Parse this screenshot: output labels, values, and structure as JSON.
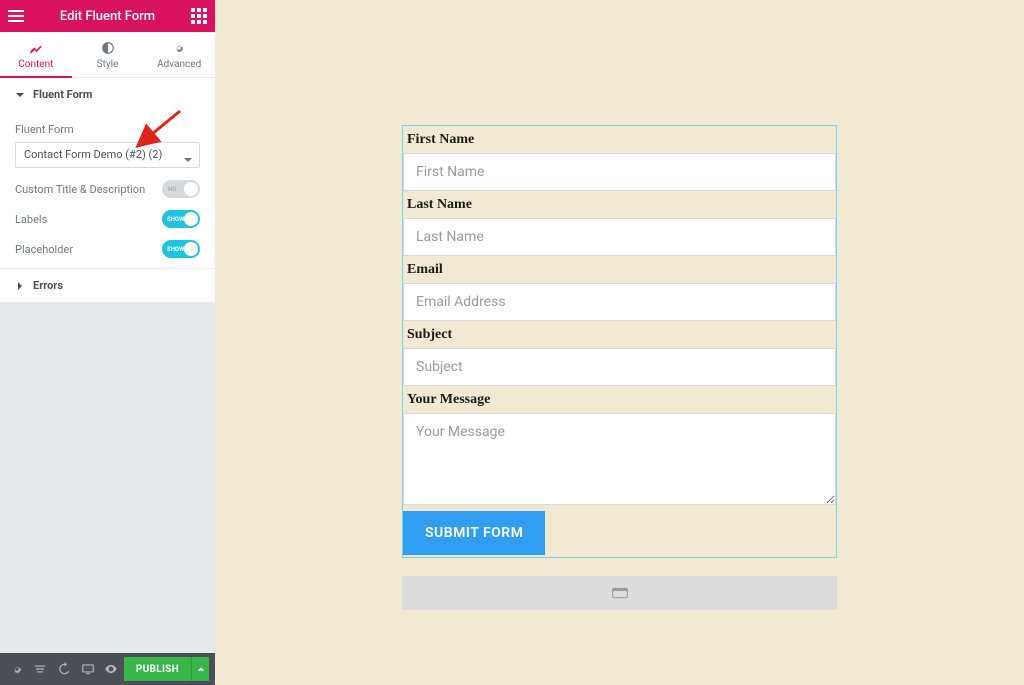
{
  "header": {
    "title": "Edit Fluent Form"
  },
  "tabs": {
    "content": "Content",
    "style": "Style",
    "advanced": "Advanced"
  },
  "sections": {
    "fluent": {
      "title": "Fluent Form",
      "select_label": "Fluent Form",
      "select_value": "Contact Form Demo (#2) (2)",
      "custom_title": "Custom Title & Description",
      "labels": "Labels",
      "placeholder": "Placeholder",
      "switch_no": "NO",
      "switch_show": "SHOW"
    },
    "errors": {
      "title": "Errors"
    }
  },
  "footer": {
    "publish": "PUBLISH"
  },
  "form": {
    "first_name_label": "First Name",
    "first_name_ph": "First Name",
    "last_name_label": "Last Name",
    "last_name_ph": "Last Name",
    "email_label": "Email",
    "email_ph": "Email Address",
    "subject_label": "Subject",
    "subject_ph": "Subject",
    "message_label": "Your Message",
    "message_ph": "Your Message",
    "submit": "SUBMIT FORM"
  }
}
